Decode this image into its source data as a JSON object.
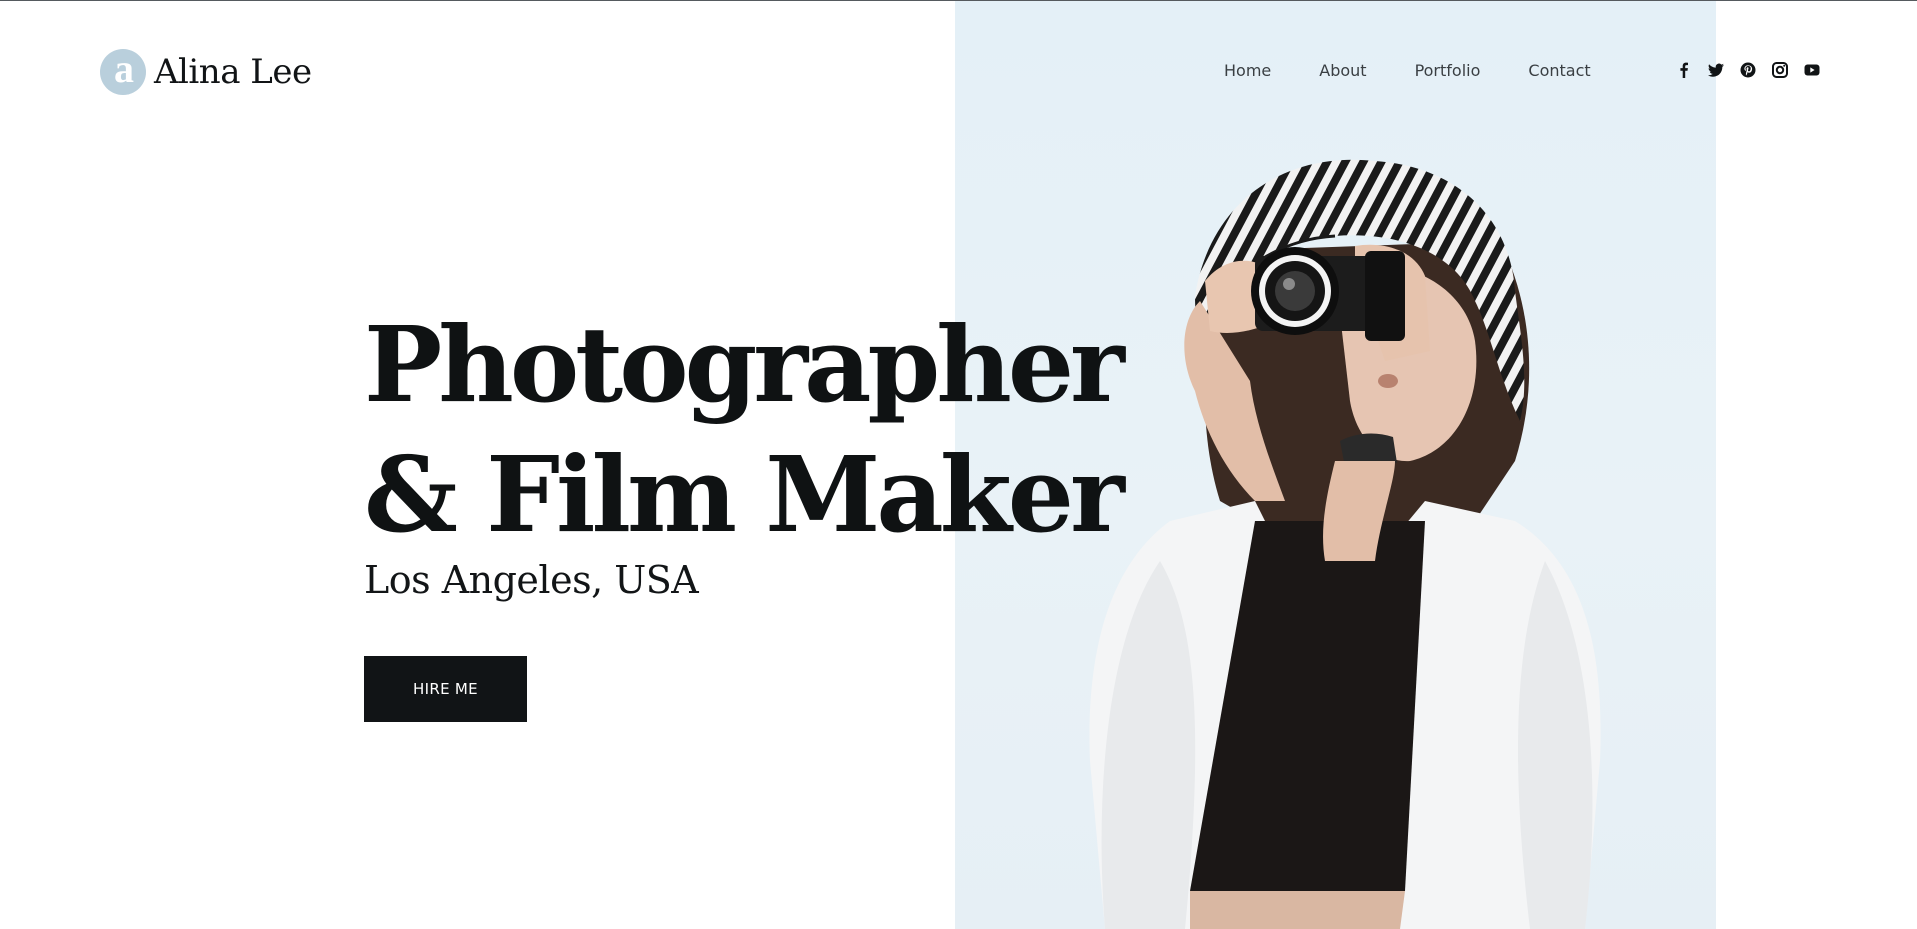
{
  "brand": {
    "logo_glyph": "a",
    "name": "Alina Lee"
  },
  "nav": {
    "items": [
      "Home",
      "About",
      "Portfolio",
      "Contact"
    ]
  },
  "social": {
    "icons": [
      "facebook-icon",
      "twitter-icon",
      "pinterest-icon",
      "instagram-icon",
      "youtube-icon"
    ]
  },
  "hero": {
    "title_line1": "Photographer",
    "title_line2": "& Film Maker",
    "location": "Los Angeles, USA",
    "cta_label": "HIRE ME"
  },
  "colors": {
    "accent_logo": "#b9cfdc",
    "panel_bg": "#e6f0f6",
    "text_dark": "#111416",
    "button_bg": "#111416"
  }
}
